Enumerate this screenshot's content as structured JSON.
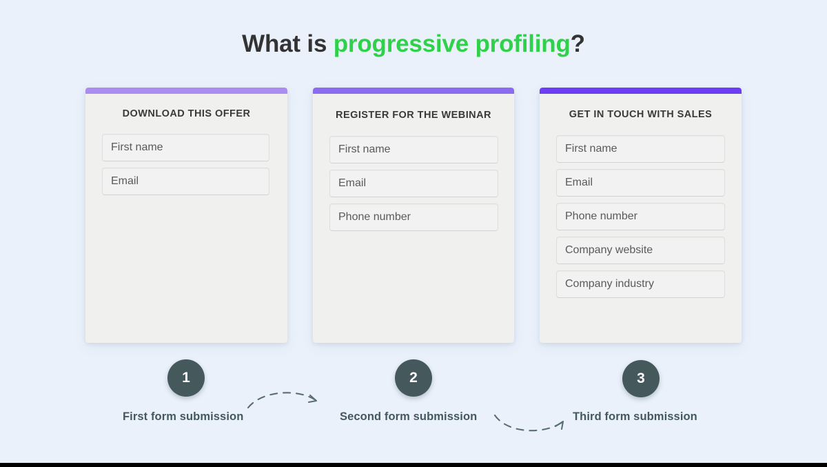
{
  "page": {
    "title_prefix": "What is ",
    "title_highlight": "progressive profiling",
    "title_suffix": "?",
    "background_color": "#eaf1fb",
    "accent_green": "#32d74b",
    "step_circle_color": "#45585c",
    "caption_color": "#44585f"
  },
  "cards": [
    {
      "id": "card-1",
      "heading": "DOWNLOAD THIS OFFER",
      "topbar_color": "#ab8cf0",
      "fields": [
        {
          "label": "First name"
        },
        {
          "label": "Email"
        }
      ]
    },
    {
      "id": "card-2",
      "heading": "REGISTER FOR THE WEBINAR",
      "topbar_color": "#8b6cf0",
      "fields": [
        {
          "label": "First name"
        },
        {
          "label": "Email"
        },
        {
          "label": "Phone number"
        }
      ]
    },
    {
      "id": "card-3",
      "heading": "GET IN TOUCH WITH SALES",
      "topbar_color": "#6b3ef5",
      "fields": [
        {
          "label": "First name"
        },
        {
          "label": "Email"
        },
        {
          "label": "Phone number"
        },
        {
          "label": "Company website"
        },
        {
          "label": "Company industry"
        }
      ]
    }
  ],
  "steps": [
    {
      "number": "1",
      "caption": "First form submission"
    },
    {
      "number": "2",
      "caption": "Second form submission"
    },
    {
      "number": "3",
      "caption": "Third form submission"
    }
  ]
}
